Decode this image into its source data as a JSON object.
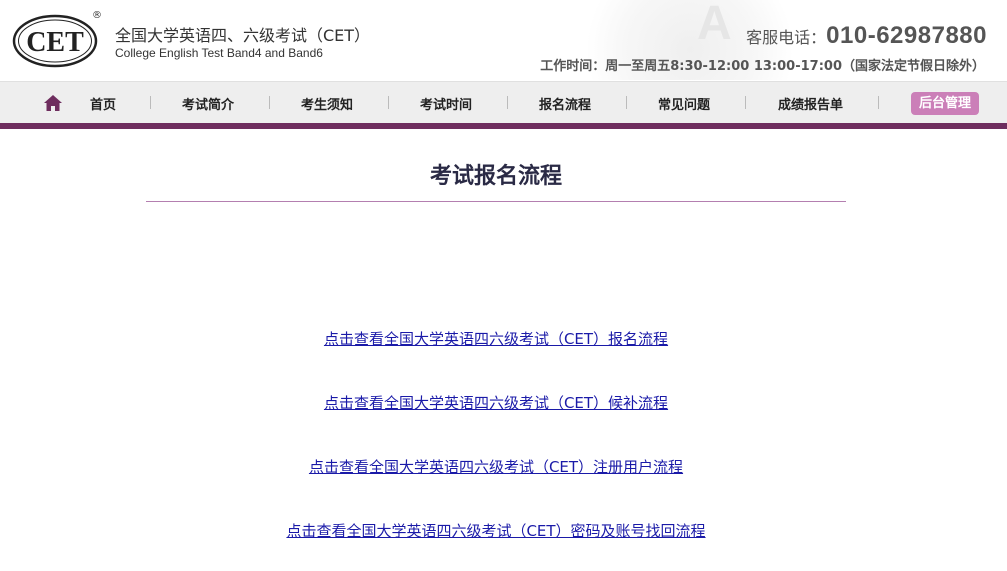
{
  "header": {
    "logo_text": "CET",
    "reg_mark": "®",
    "title_cn": "全国大学英语四、六级考试（CET）",
    "title_en": "College English Test Band4 and Band6",
    "phone_label": "客服电话：",
    "phone_number": "010-62987880",
    "hours": "工作时间：周一至周五8:30-12:00 13:00-17:00（国家法定节假日除外）"
  },
  "nav": {
    "items": [
      {
        "label": "首页"
      },
      {
        "label": "考试简介"
      },
      {
        "label": "考生须知"
      },
      {
        "label": "考试时间"
      },
      {
        "label": "报名流程"
      },
      {
        "label": "常见问题"
      },
      {
        "label": "成绩报告单"
      }
    ],
    "admin_label": "后台管理"
  },
  "main": {
    "title": "考试报名流程",
    "links": [
      {
        "label": "点击查看全国大学英语四六级考试（CET）报名流程"
      },
      {
        "label": "点击查看全国大学英语四六级考试（CET）候补流程"
      },
      {
        "label": "点击查看全国大学英语四六级考试（CET）注册用户流程"
      },
      {
        "label": "点击查看全国大学英语四六级考试（CET）密码及账号找回流程"
      }
    ]
  },
  "colors": {
    "accent": "#6e2d5e",
    "admin_button": "#cb7fb8",
    "link": "#1a1aa8",
    "title_rule": "#b47fb0"
  },
  "icons": {
    "home": "home-icon"
  }
}
